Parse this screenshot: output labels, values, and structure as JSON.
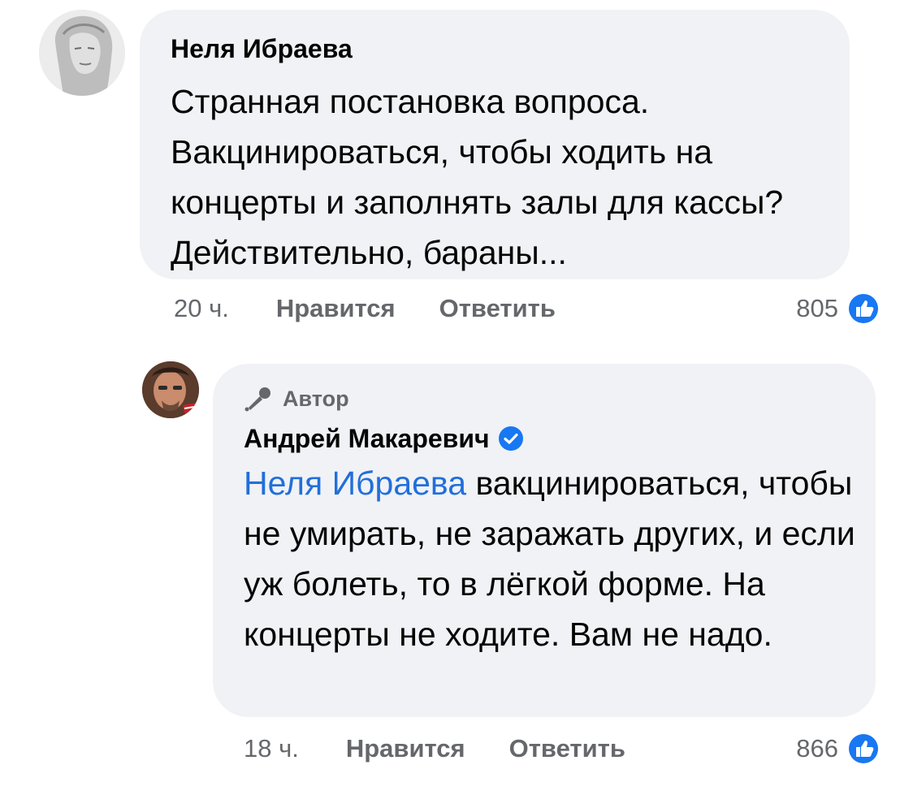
{
  "comments": [
    {
      "author": "Неля Ибраева",
      "text": "Странная постановка вопроса. Вакцинироваться, чтобы ходить на концерты и заполнять залы для кассы? Действительно, бараны...",
      "time": "20 ч.",
      "like_label": "Нравится",
      "reply_label": "Ответить",
      "reactions": "805"
    },
    {
      "badge": "Автор",
      "author": "Андрей Макаревич",
      "mention": "Неля Ибраева",
      "text": " вакцинироваться, чтобы не умирать, не заражать других, и если уж болеть, то в лёгкой форме. На концерты не ходите. Вам не надо.",
      "time": "18 ч.",
      "like_label": "Нравится",
      "reply_label": "Ответить",
      "reactions": "866"
    }
  ],
  "colors": {
    "bubble": "#f0f2f5",
    "mention": "#216fdb",
    "meta": "#65676b",
    "like": "#1877f2"
  },
  "icons": [
    "like-reaction-icon",
    "microphone-icon",
    "verified-badge-icon"
  ]
}
